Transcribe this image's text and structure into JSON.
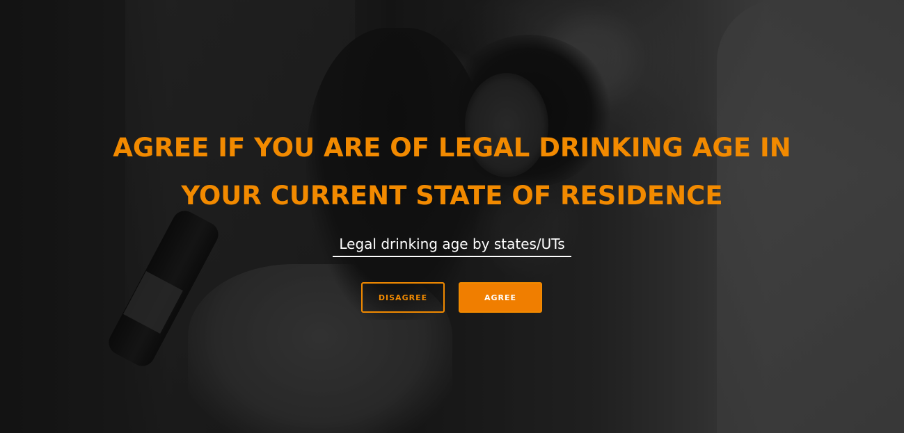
{
  "age_gate": {
    "headline_line1": "AGREE IF YOU ARE OF LEGAL DRINKING AGE IN",
    "headline_line2": "YOUR CURRENT STATE OF RESIDENCE",
    "info_link": "Legal drinking age by states/UTs",
    "disagree_label": "DISAGREE",
    "agree_label": "AGREE"
  },
  "colors": {
    "accent": "#f28a00",
    "agree_fill": "#f07e00",
    "link_text": "#ffffff",
    "overlay": "#000000"
  }
}
